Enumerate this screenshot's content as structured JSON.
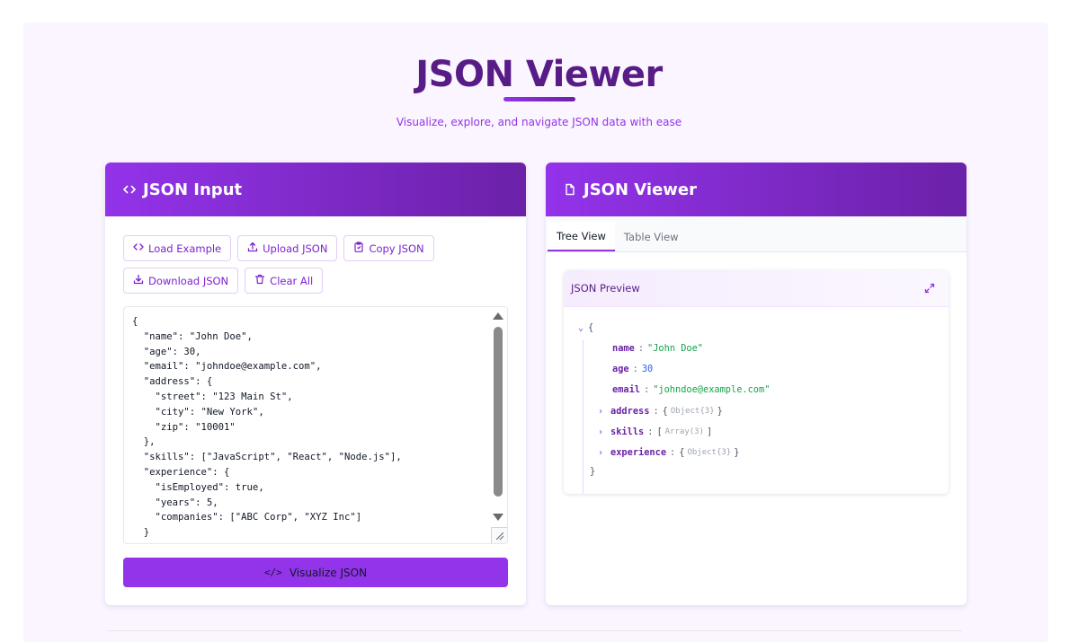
{
  "header": {
    "title": "JSON Viewer",
    "subtitle": "Visualize, explore, and navigate JSON data with ease"
  },
  "input_panel": {
    "title": "JSON Input",
    "buttons": {
      "load_example": "Load Example",
      "upload_json": "Upload JSON",
      "copy_json": "Copy JSON",
      "download_json": "Download JSON",
      "clear_all": "Clear All"
    },
    "editor_text": "{\n  \"name\": \"John Doe\",\n  \"age\": 30,\n  \"email\": \"johndoe@example.com\",\n  \"address\": {\n    \"street\": \"123 Main St\",\n    \"city\": \"New York\",\n    \"zip\": \"10001\"\n  },\n  \"skills\": [\"JavaScript\", \"React\", \"Node.js\"],\n  \"experience\": {\n    \"isEmployed\": true,\n    \"years\": 5,\n    \"companies\": [\"ABC Corp\", \"XYZ Inc\"]\n  }\n}",
    "visualize_button": "Visualize JSON",
    "visualize_icon": "</>"
  },
  "viewer_panel": {
    "title": "JSON Viewer",
    "tabs": [
      "Tree View",
      "Table View"
    ],
    "active_tab": "Tree View",
    "preview_title": "JSON Preview",
    "tree": {
      "open_brace": "{",
      "close_brace": "}",
      "name_key": "name",
      "name_value": "\"John Doe\"",
      "age_key": "age",
      "age_value": "30",
      "email_key": "email",
      "email_value": "\"johndoe@example.com\"",
      "address_key": "address",
      "address_meta": "Object{3}",
      "skills_key": "skills",
      "skills_meta": "Array(3)",
      "experience_key": "experience",
      "experience_meta": "Object{3}"
    }
  },
  "icons": {
    "code": "code-icon",
    "file": "file-icon",
    "upload": "upload-icon",
    "copy": "clipboard-icon",
    "download": "download-icon",
    "trash": "trash-icon",
    "expand": "expand-icon"
  },
  "colors": {
    "accent": "#9333ea",
    "accent_dark": "#6b21a8",
    "title": "#581c87",
    "string_value": "#16a34a",
    "number_value": "#2563eb"
  }
}
